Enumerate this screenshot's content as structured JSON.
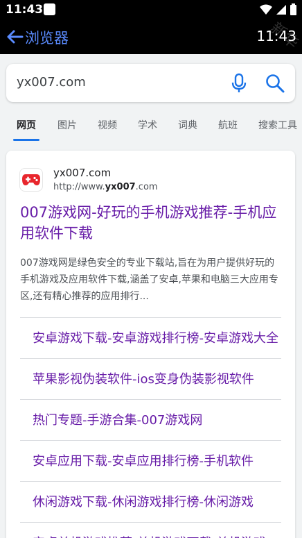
{
  "status_bar": {
    "time": "11:43"
  },
  "app_bar": {
    "back_arrow": "←",
    "title": "浏览器",
    "clock": "11:43",
    "watermark": "新华"
  },
  "search": {
    "query": "yx007.com"
  },
  "tabs": [
    {
      "label": "网页",
      "active": true
    },
    {
      "label": "图片",
      "active": false
    },
    {
      "label": "视频",
      "active": false
    },
    {
      "label": "学术",
      "active": false
    },
    {
      "label": "词典",
      "active": false
    },
    {
      "label": "航班",
      "active": false
    },
    {
      "label": "搜索工具",
      "active": false
    }
  ],
  "result": {
    "site_name": "yx007.com",
    "url_prefix": "http://www.",
    "url_bold": "yx007",
    "url_suffix": ".com",
    "title": "007游戏网-好玩的手机游戏推荐-手机应用软件下载",
    "snippet": "007游戏网是绿色安全的专业下载站,旨在为用户提供好玩的手机游戏及应用软件下载,涵盖了安卓,苹果和电脑三大应用专区,还有精心推荐的应用排行...",
    "sub_links": [
      "安卓游戏下载-安卓游戏排行榜-安卓游戏大全",
      "苹果影视伪装软件-ios变身伪装影视软件",
      "热门专题-手游合集-007游戏网",
      "安卓应用下载-安卓应用排行榜-手机软件",
      "休闲游戏下载-休闲游戏排行榜-休闲游戏",
      "安卓单机游戏推荐-单机游戏下载-单机游戏"
    ]
  },
  "colors": {
    "link_visited": "#681da8",
    "accent": "#1a73e8",
    "app_title": "#5a8bff"
  },
  "icons": {
    "back": "arrow-left-icon",
    "mic": "mic-icon",
    "search": "search-icon",
    "favicon": "gamepad-icon"
  }
}
